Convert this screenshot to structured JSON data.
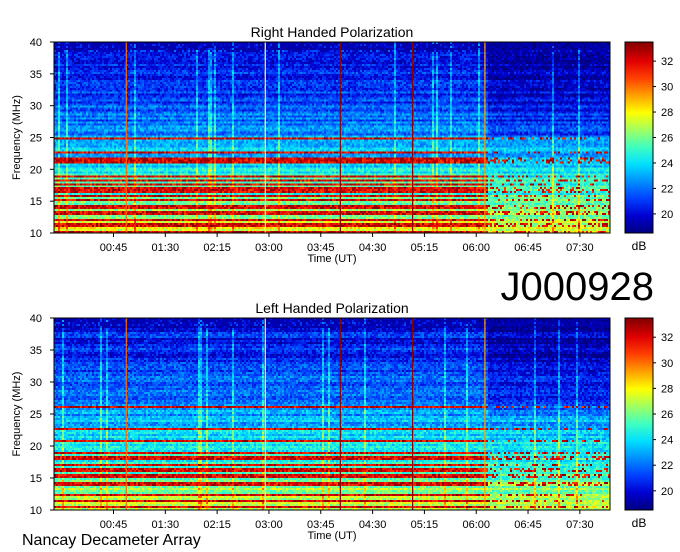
{
  "header": {
    "code": "J000928"
  },
  "footer": {
    "label": "Nancay Decameter Array"
  },
  "colormap": [
    "#000080",
    "#0000d0",
    "#0040ff",
    "#0090ff",
    "#00dfff",
    "#40ffc0",
    "#a0ff60",
    "#ffff00",
    "#ffa000",
    "#ff4000",
    "#e00000",
    "#800000"
  ],
  "chart_data": [
    {
      "type": "heatmap",
      "title": "Right Handed Polarization",
      "xlabel": "Time (UT)",
      "ylabel": "Frequency (MHz)",
      "x_ticks": [
        "00:45",
        "01:30",
        "02:15",
        "03:00",
        "03:45",
        "04:30",
        "05:15",
        "06:00",
        "06:45",
        "07:30"
      ],
      "y_ticks": [
        10,
        15,
        20,
        25,
        30,
        35,
        40
      ],
      "ylim": [
        10,
        40
      ],
      "colorbar": {
        "label": "dB",
        "ticks": [
          20,
          22,
          24,
          26,
          28,
          30,
          32
        ],
        "range": [
          18.5,
          33.5
        ]
      }
    },
    {
      "type": "heatmap",
      "title": "Left Handed Polarization",
      "xlabel": "Time (UT)",
      "ylabel": "Frequency (MHz)",
      "x_ticks": [
        "00:45",
        "01:30",
        "02:15",
        "03:00",
        "03:45",
        "04:30",
        "05:15",
        "06:00",
        "06:45",
        "07:30"
      ],
      "y_ticks": [
        10,
        15,
        20,
        25,
        30,
        35,
        40
      ],
      "ylim": [
        10,
        40
      ],
      "colorbar": {
        "label": "dB",
        "ticks": [
          20,
          22,
          24,
          26,
          28,
          30,
          32
        ],
        "range": [
          18.5,
          33.5
        ]
      }
    }
  ]
}
